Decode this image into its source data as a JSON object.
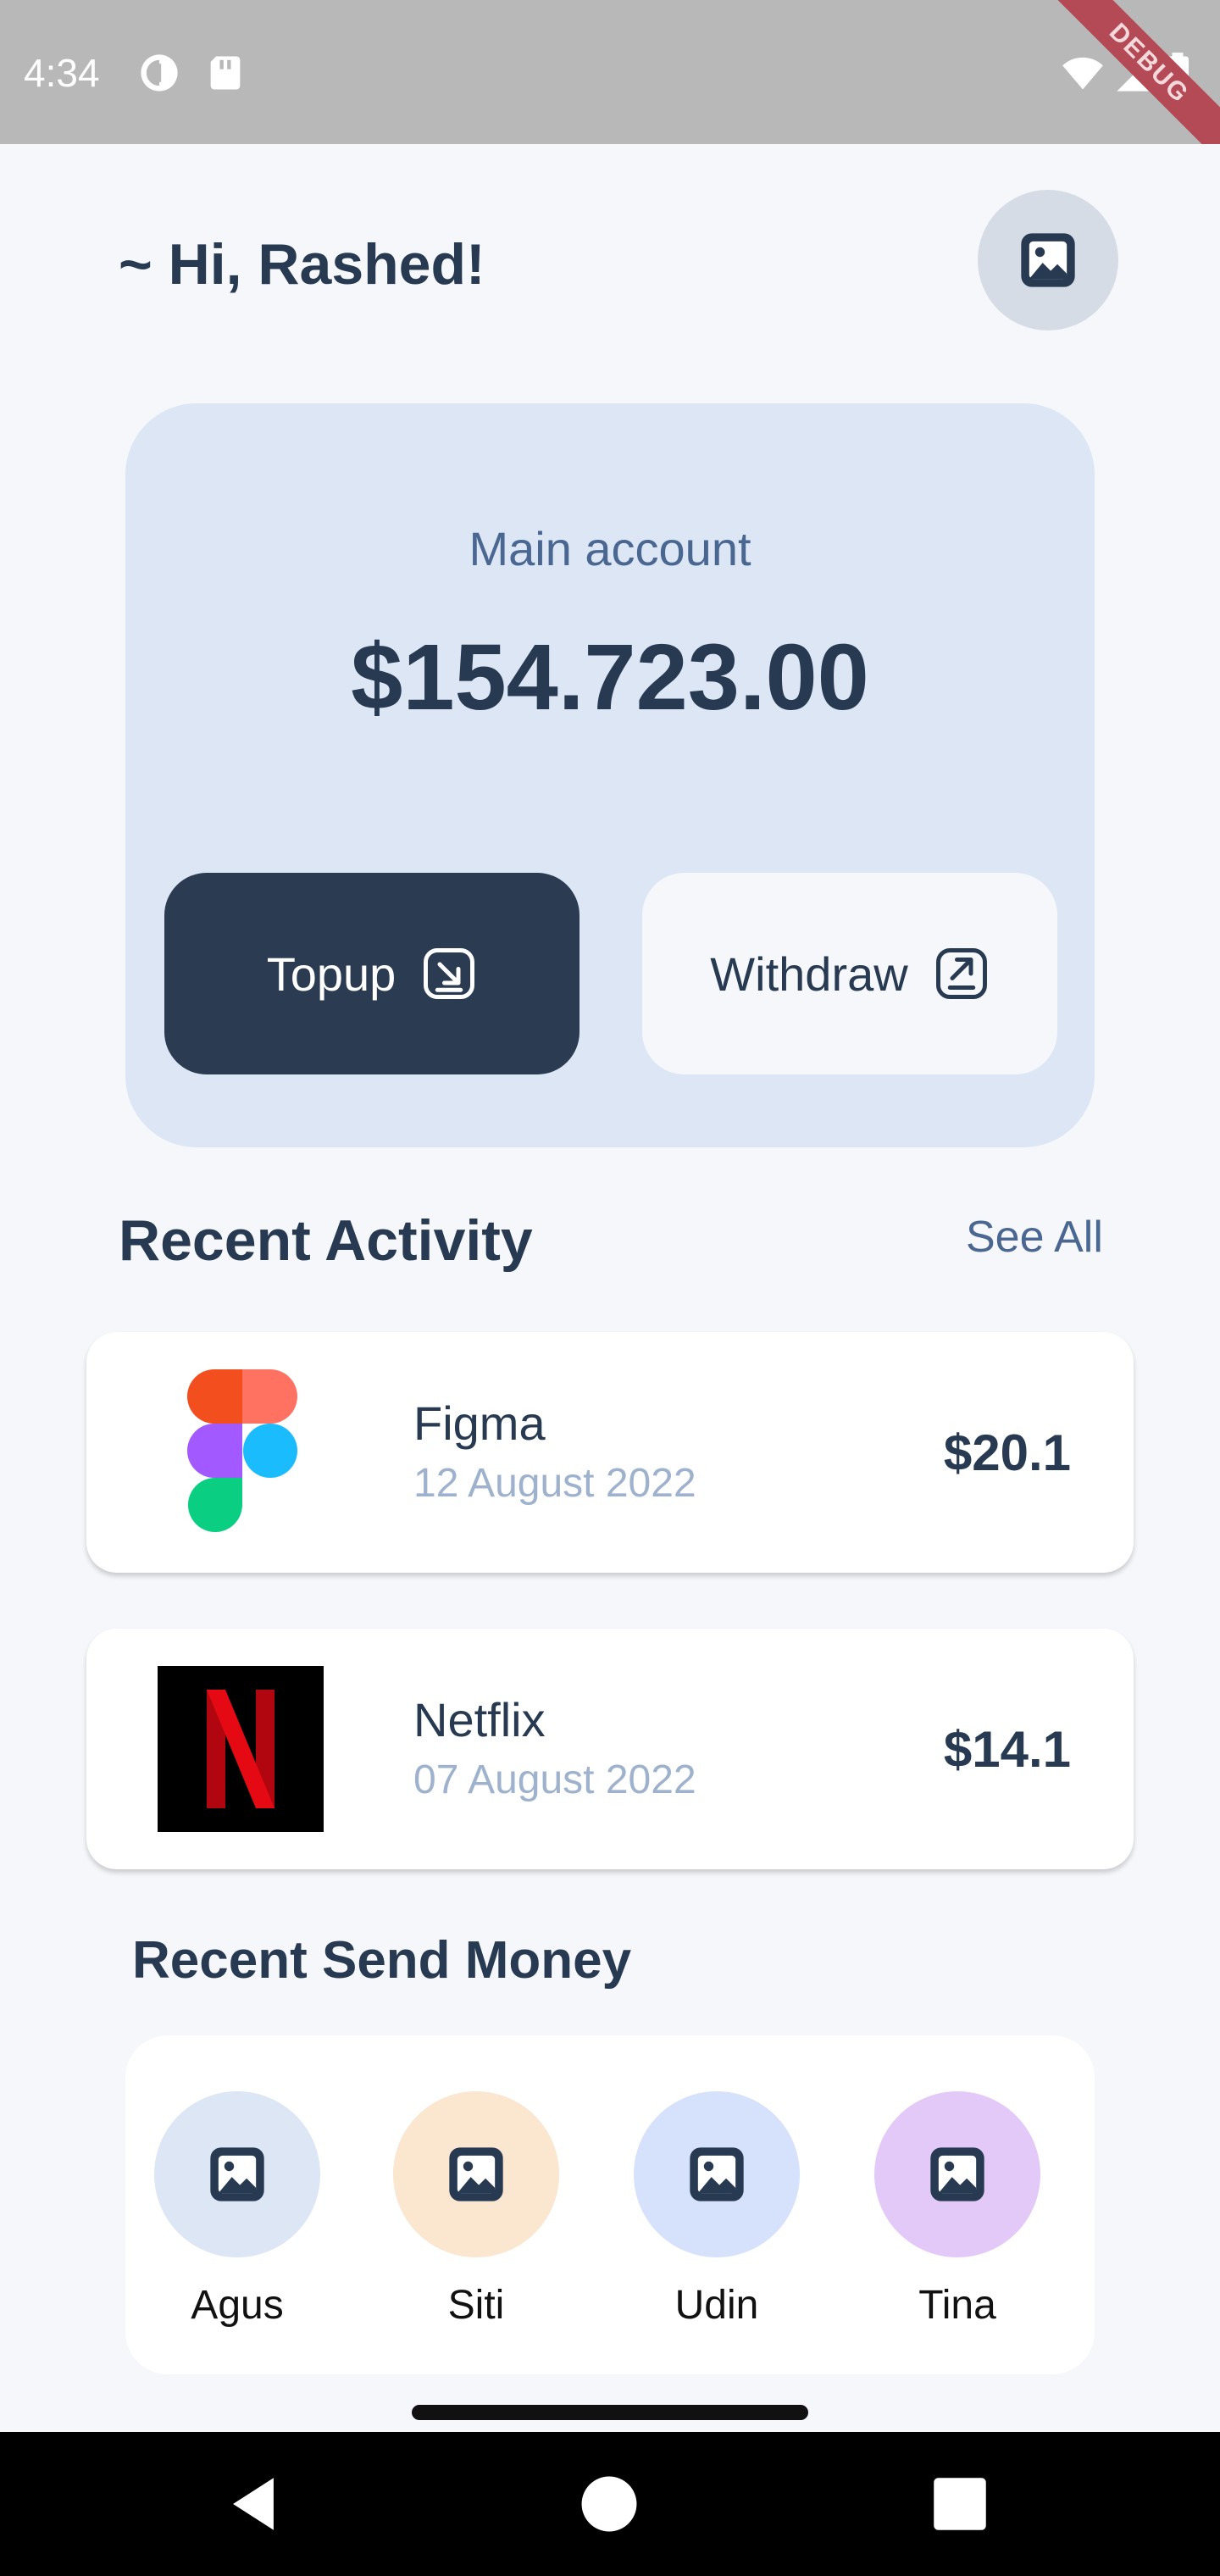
{
  "status_bar": {
    "time": "4:34",
    "debug_label": "DEBUG",
    "icons": [
      "data-saver-icon",
      "sd-card-icon",
      "wifi-icon",
      "cell-signal-icon",
      "battery-icon"
    ]
  },
  "header": {
    "greeting": "~ Hi, Rashed!",
    "avatar_icon": "image-placeholder-icon"
  },
  "balance": {
    "label": "Main account",
    "amount": "$154.723.00",
    "topup_label": "Topup",
    "topup_icon": "arrow-down-right-icon",
    "withdraw_label": "Withdraw",
    "withdraw_icon": "arrow-up-right-icon"
  },
  "recent_activity": {
    "title": "Recent Activity",
    "see_all": "See All",
    "items": [
      {
        "name": "Figma",
        "date": "12 August 2022",
        "amount": "$20.1",
        "logo": "figma-logo"
      },
      {
        "name": "Netflix",
        "date": "07 August 2022",
        "amount": "$14.1",
        "logo": "netflix-logo"
      }
    ]
  },
  "recent_send": {
    "title": "Recent Send Money",
    "contacts": [
      {
        "name": "Agus",
        "color": "#dce6f4"
      },
      {
        "name": "Siti",
        "color": "#fbe6d0"
      },
      {
        "name": "Udin",
        "color": "#d6e2fb"
      },
      {
        "name": "Tina",
        "color": "#e3c9f7"
      }
    ]
  },
  "colors": {
    "background": "#f5f7fb",
    "primary_dark": "#2b3b51",
    "card_blue": "#dce6f4",
    "muted_text": "#9eb2cd"
  },
  "nav_bar": {
    "buttons": [
      "back-icon",
      "home-icon",
      "recents-icon"
    ]
  }
}
